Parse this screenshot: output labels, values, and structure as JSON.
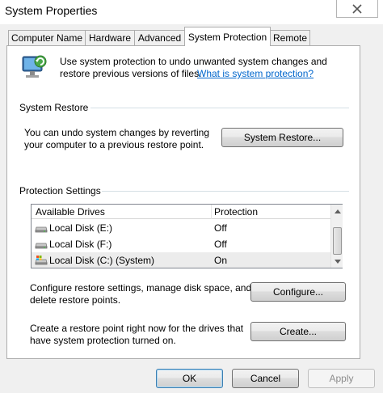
{
  "window": {
    "title": "System Properties"
  },
  "tabs": [
    {
      "label": "Computer Name"
    },
    {
      "label": "Hardware"
    },
    {
      "label": "Advanced"
    },
    {
      "label": "System Protection"
    },
    {
      "label": "Remote"
    }
  ],
  "intro": {
    "text_line1": "Use system protection to undo unwanted system changes and",
    "text_line2": "restore previous versions of files.",
    "link": "What is system protection?"
  },
  "system_restore": {
    "group_label": "System Restore",
    "desc_line1": "You can undo system changes by reverting",
    "desc_line2": "your computer to a previous restore point.",
    "button": "System Restore..."
  },
  "protection_settings": {
    "group_label": "Protection Settings",
    "columns": [
      "Available Drives",
      "Protection"
    ],
    "drives": [
      {
        "name": "Local Disk (E:)",
        "protection": "Off",
        "icon": "hard-drive-icon"
      },
      {
        "name": "Local Disk (F:)",
        "protection": "Off",
        "icon": "hard-drive-icon"
      },
      {
        "name": "Local Disk (C:) (System)",
        "protection": "On",
        "icon": "system-drive-icon"
      }
    ],
    "configure_line1": "Configure restore settings, manage disk space, and",
    "configure_line2": "delete restore points.",
    "configure_button": "Configure...",
    "create_line1": "Create a restore point right now for the drives that",
    "create_line2": "have system protection turned on.",
    "create_button": "Create..."
  },
  "footer": {
    "ok": "OK",
    "cancel": "Cancel",
    "apply": "Apply"
  }
}
